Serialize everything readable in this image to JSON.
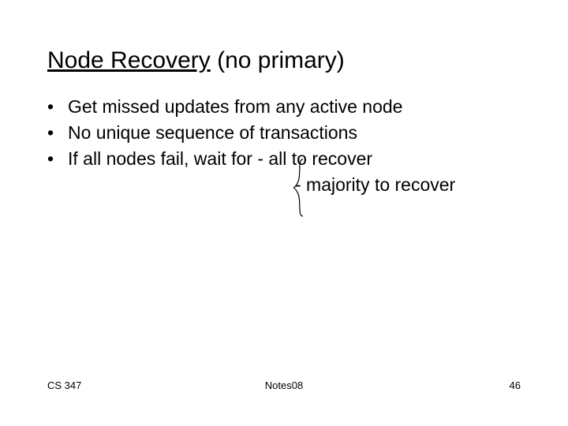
{
  "title": {
    "underlined": "Node Recovery",
    "rest": "  (no primary)"
  },
  "bullets": {
    "b1": "Get missed updates from any active node",
    "b2": "No unique sequence of transactions",
    "b3": "If all nodes fail, wait for - all to recover",
    "b3cont": "- majority to recover"
  },
  "footer": {
    "left": "CS 347",
    "center": "Notes08",
    "right": "46"
  }
}
